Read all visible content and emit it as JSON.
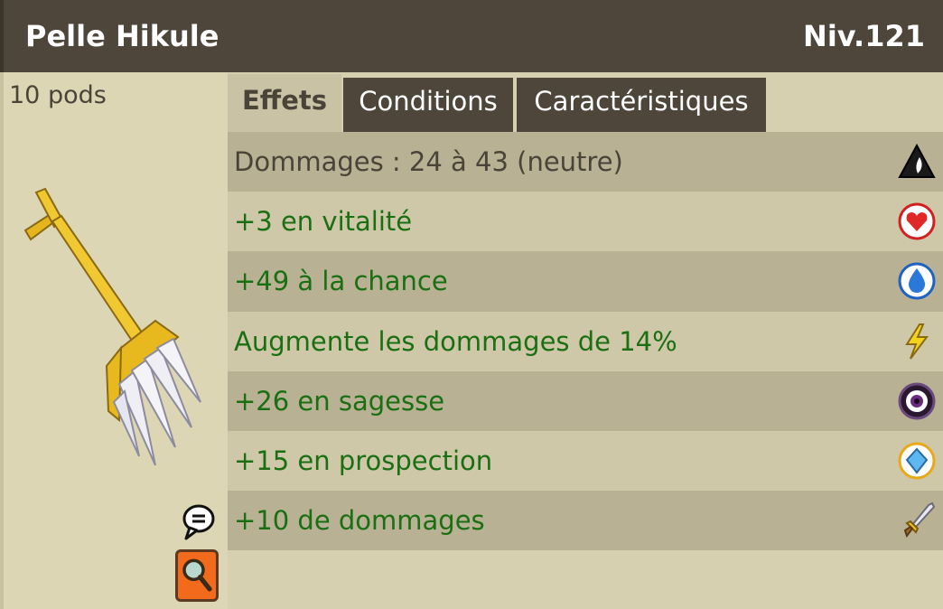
{
  "item": {
    "name": "Pelle Hikule",
    "level": "Niv.121",
    "weight": "10 pods"
  },
  "tabs": [
    {
      "label": "Effets",
      "active": true
    },
    {
      "label": "Conditions",
      "active": false
    },
    {
      "label": "Caractéristiques",
      "active": false
    }
  ],
  "effects": [
    {
      "text": "Dommages : 24 à 43 (neutre)",
      "icon": "neutral-element-icon"
    },
    {
      "text": "+3 en vitalité",
      "icon": "heart-icon"
    },
    {
      "text": "+49 à la chance",
      "icon": "water-drop-icon"
    },
    {
      "text": "Augmente les dommages de 14%",
      "icon": "lightning-icon"
    },
    {
      "text": "+26 en sagesse",
      "icon": "wisdom-eye-icon"
    },
    {
      "text": "+15 en prospection",
      "icon": "prospecting-gem-icon"
    },
    {
      "text": "+10 de dommages",
      "icon": "sword-icon"
    }
  ],
  "colors": {
    "title_bg": "#4f463b",
    "bonus_text": "#1a6f12",
    "row_dark": "#b8b194",
    "row_light": "#cfc8a8"
  }
}
